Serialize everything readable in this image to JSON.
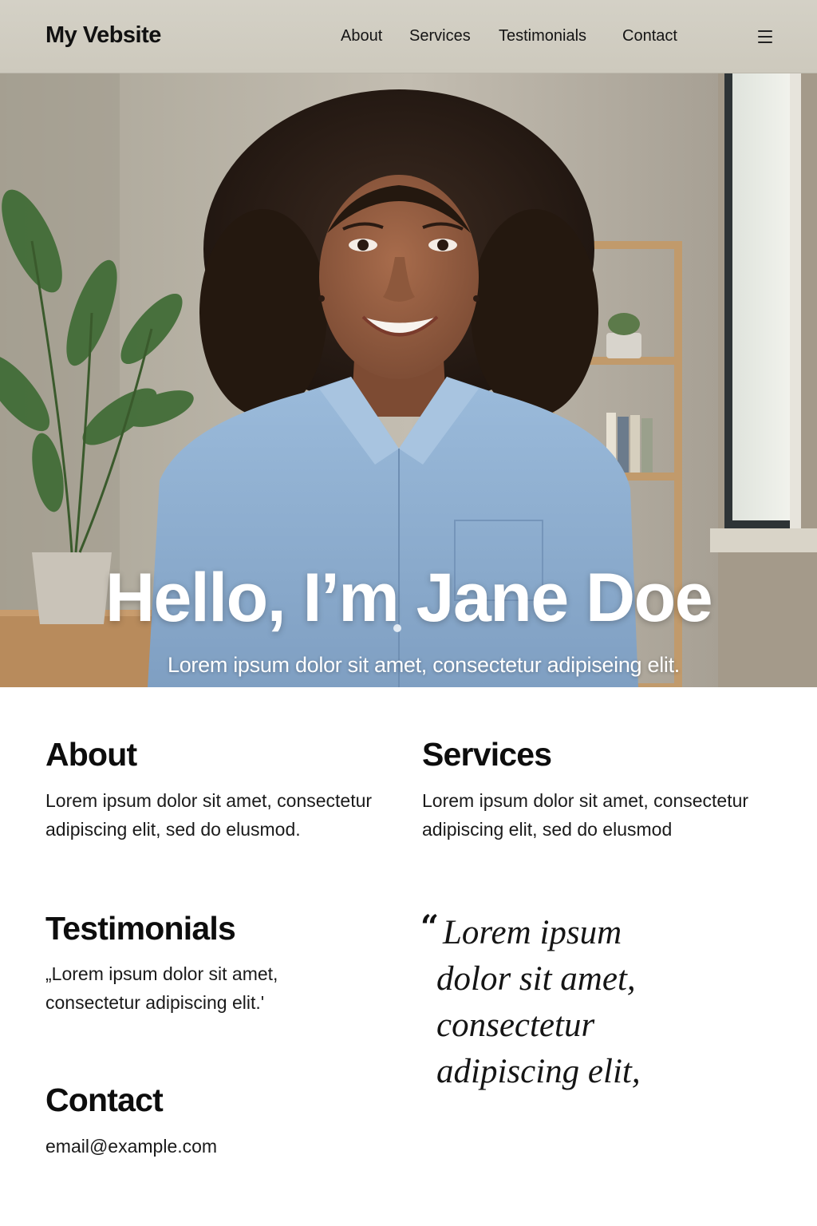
{
  "header": {
    "logo": "My Vebsite",
    "nav": [
      "About",
      "Services",
      "Testimonials",
      "Contact"
    ],
    "menu_icon": "hamburger-menu-icon"
  },
  "hero": {
    "title": "Hello, I’m Jane Doe",
    "subtitle": "Lorem ipsum dolor sit amet, consectetur adipiseing elit.",
    "image": "portrait-photo"
  },
  "sections": {
    "about": {
      "title": "About",
      "text": "Lorem ipsum dolor sit amet, consectetur adipiscing elit, sed do elusmod."
    },
    "services": {
      "title": "Services",
      "text": "Lorem ipsum dolor sit amet, consectetur adipiscing elit, sed do elusmod"
    },
    "testimonials": {
      "title": "Testimonials",
      "text": "„Lorem ipsum dolor sit amet, consectetur adipiscing elit.'"
    },
    "contact": {
      "title": "Contact",
      "email": "email@example.com"
    },
    "quote": {
      "mark": "“",
      "lines": [
        "Lorem ipsum",
        "dolor sit amet,",
        "consectetur",
        "adipiscing elit,"
      ]
    }
  },
  "colors": {
    "header_bg": "#cfcbc0",
    "hero_text": "#ffffff",
    "shirt_blue": "#8fb0d2"
  }
}
